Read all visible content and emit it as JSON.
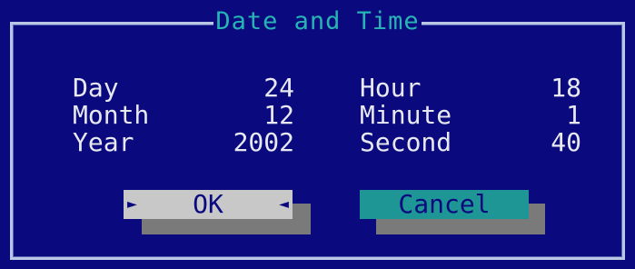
{
  "dialog": {
    "title": "Date and Time"
  },
  "fields": {
    "day": {
      "label": "Day",
      "value": "24"
    },
    "month": {
      "label": "Month",
      "value": "12"
    },
    "year": {
      "label": "Year",
      "value": "2002"
    },
    "hour": {
      "label": "Hour",
      "value": "18"
    },
    "minute": {
      "label": "Minute",
      "value": "1"
    },
    "second": {
      "label": "Second",
      "value": "40"
    }
  },
  "buttons": {
    "ok": {
      "label": "OK",
      "left_marker": "►",
      "right_marker": "◄"
    },
    "cancel": {
      "label": "Cancel"
    }
  },
  "colors": {
    "background": "#0a0a7e",
    "title": "#28b4b4",
    "text": "#e8e8f0",
    "ok_button": "#c8c8c8",
    "cancel_button": "#1e9696",
    "shadow": "#7a7a7a",
    "border": "#b9c6e6"
  }
}
